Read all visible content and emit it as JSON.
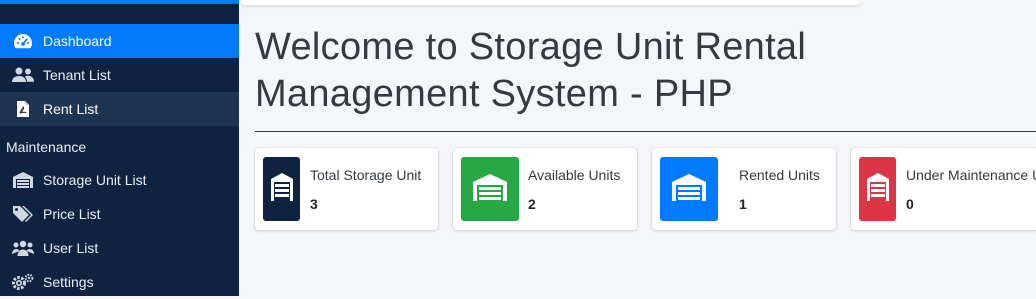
{
  "sidebar": {
    "items": [
      {
        "label": "Dashboard",
        "icon": "tachometer-icon"
      },
      {
        "label": "Tenant List",
        "icon": "users-icon"
      },
      {
        "label": "Rent List",
        "icon": "file-icon"
      }
    ],
    "section_header": "Maintenance",
    "maintenance_items": [
      {
        "label": "Storage Unit List",
        "icon": "warehouse-icon"
      },
      {
        "label": "Price List",
        "icon": "tags-icon"
      },
      {
        "label": "User List",
        "icon": "users-cog-icon"
      },
      {
        "label": "Settings",
        "icon": "cogs-icon"
      }
    ]
  },
  "main": {
    "title_line1": "Welcome to Storage Unit Rental",
    "title_line2": "Management System - PHP",
    "cards": [
      {
        "label": "Total Storage Unit",
        "value": "3",
        "color": "#0f2340"
      },
      {
        "label": "Available Units",
        "value": "2",
        "color": "#28a745"
      },
      {
        "label": "Rented Units",
        "value": "1",
        "color": "#007bff"
      },
      {
        "label": "Under Maintenance Units",
        "value": "0",
        "color": "#dc3545"
      }
    ]
  },
  "colors": {
    "sidebar_bg": "#0f2340",
    "active": "#007bff",
    "page_bg": "#f4f6f9"
  }
}
